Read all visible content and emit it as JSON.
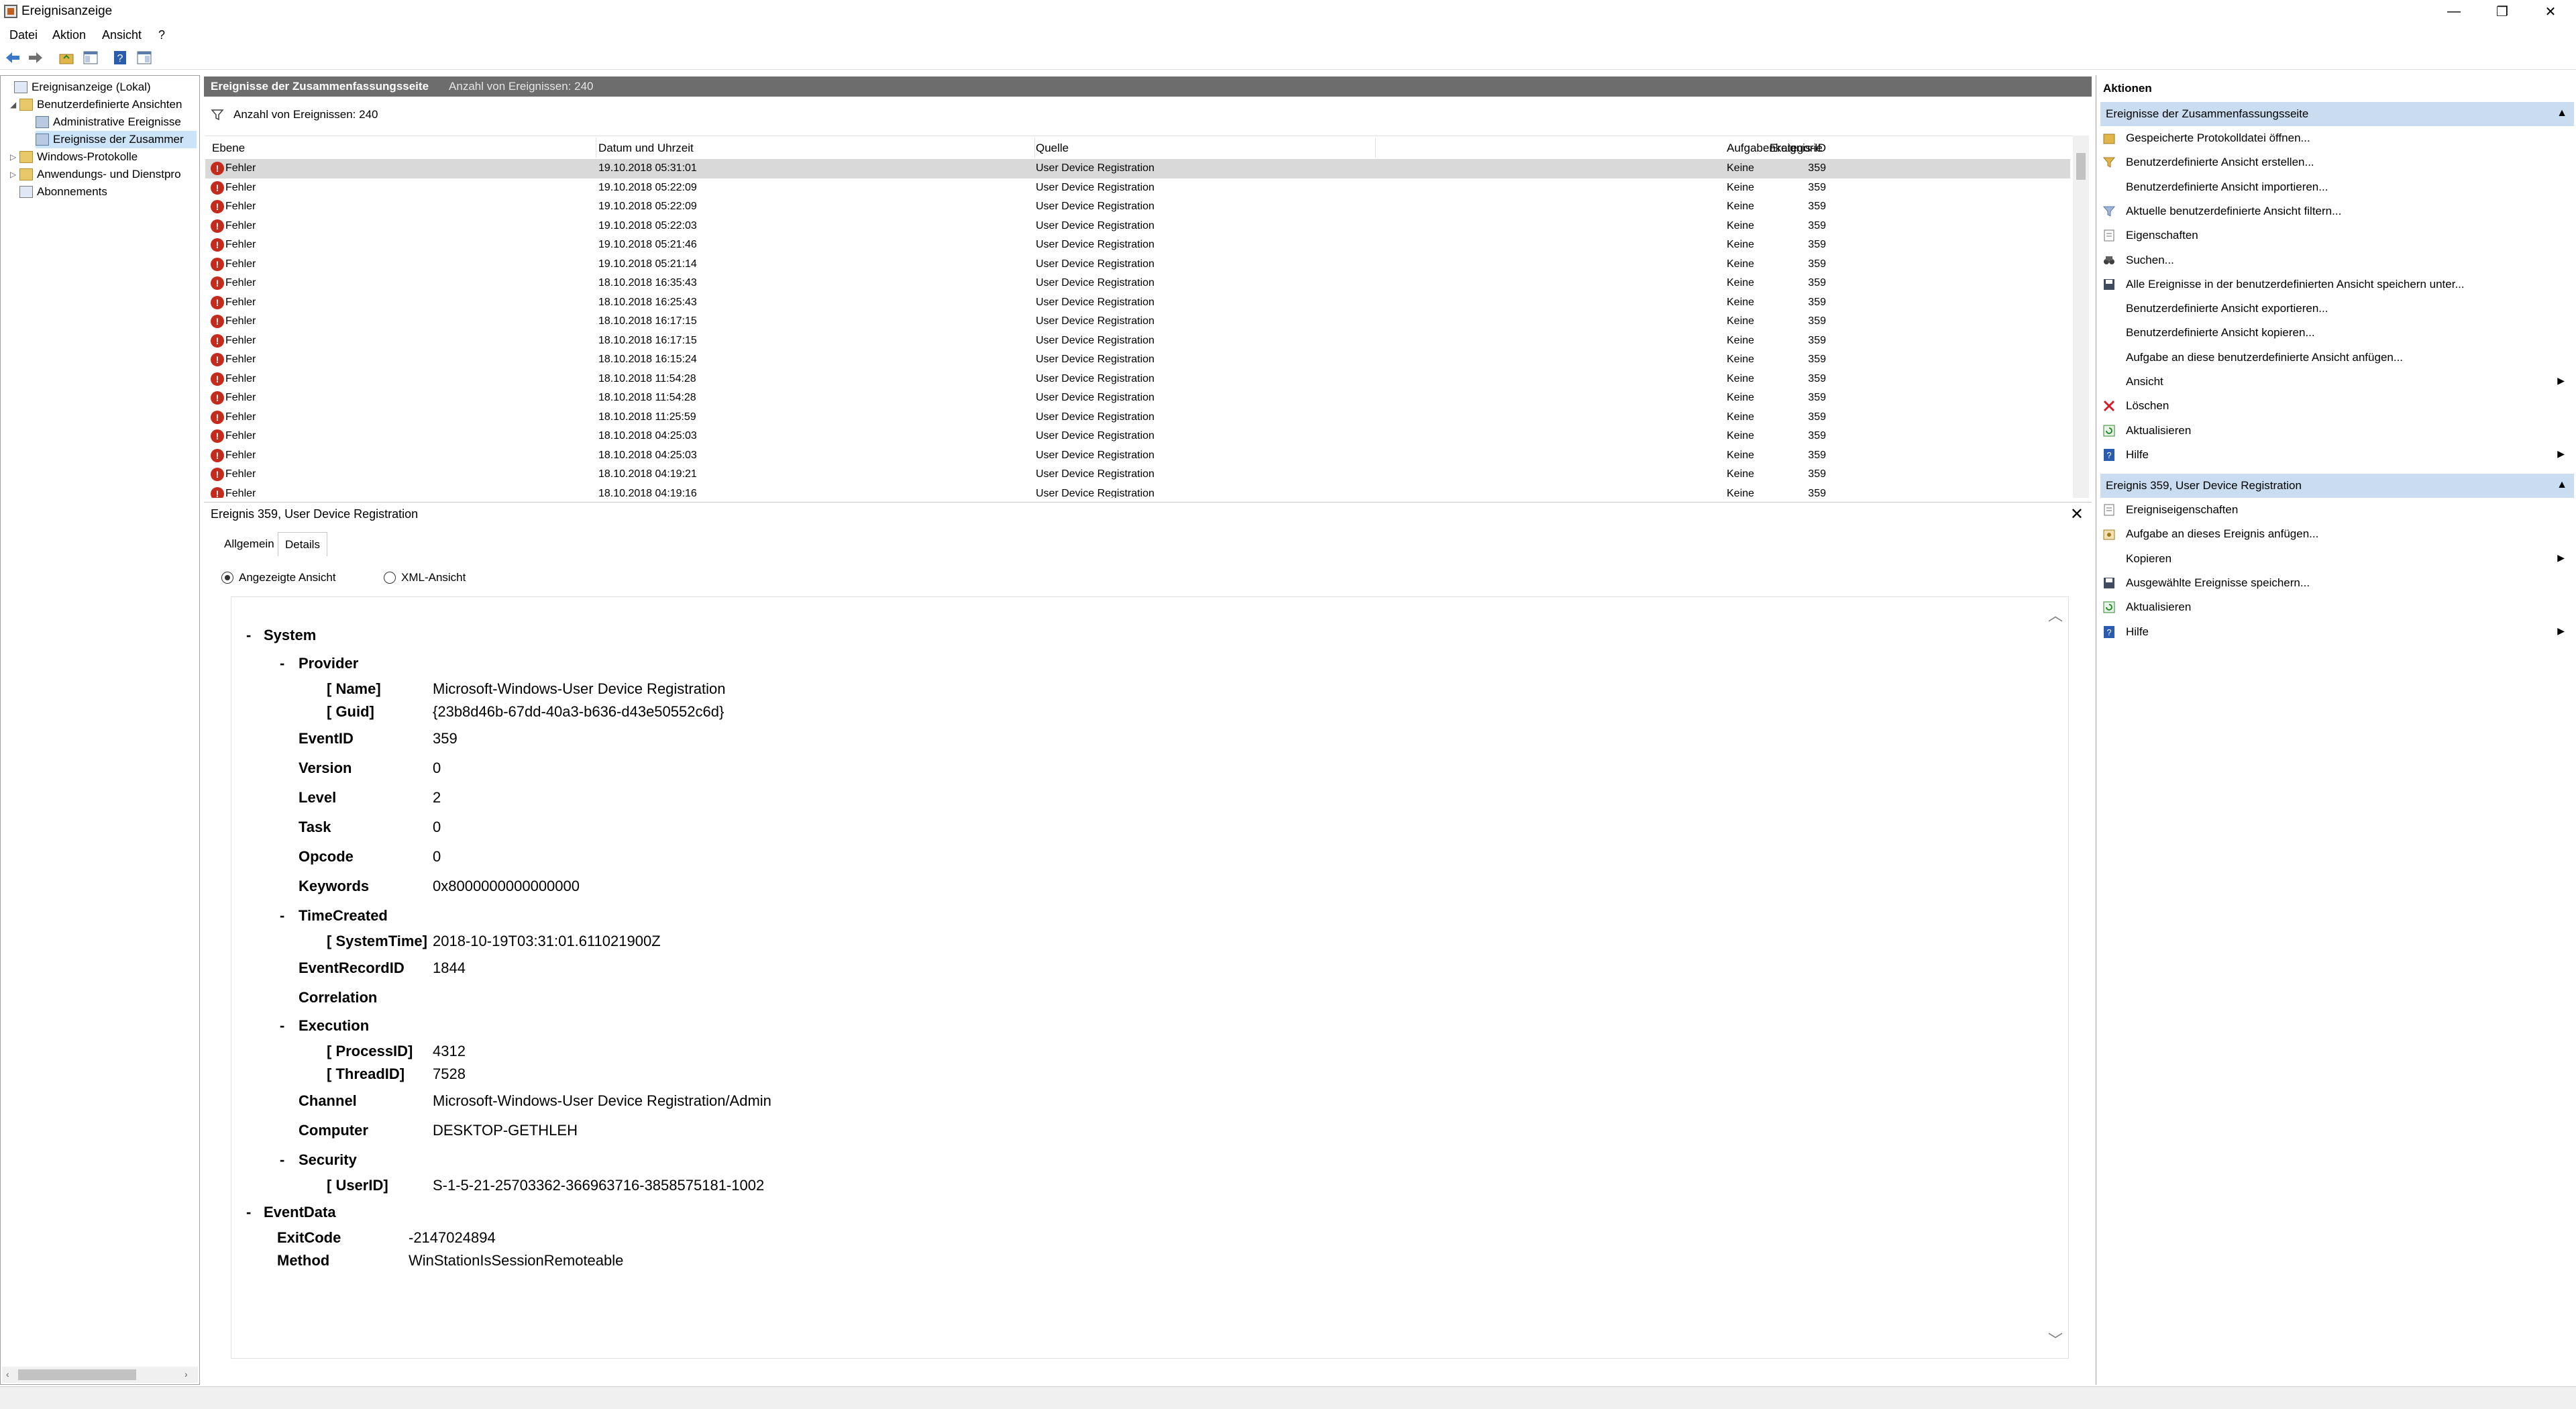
{
  "window": {
    "title": "Ereignisanzeige",
    "minimize": "—",
    "restore": "❐",
    "close": "✕"
  },
  "menu": [
    "Datei",
    "Aktion",
    "Ansicht",
    "?"
  ],
  "tree": {
    "items": [
      {
        "label": "Ereignisanzeige (Lokal)"
      },
      {
        "label": "Benutzerdefinierte Ansichten"
      },
      {
        "label": "Administrative Ereignisse"
      },
      {
        "label": "Ereignisse der Zusammer"
      },
      {
        "label": "Windows-Protokolle"
      },
      {
        "label": "Anwendungs- und Dienstpro"
      },
      {
        "label": "Abonnements"
      }
    ]
  },
  "summary": {
    "title": "Ereignisse der Zusammenfassungsseite",
    "count_label": "Anzahl von Ereignissen: 240",
    "filter_text": "Anzahl von Ereignissen: 240"
  },
  "table": {
    "columns": [
      "Ebene",
      "Datum und Uhrzeit",
      "Quelle",
      "Ereignis-ID",
      "Aufgabenkategorie"
    ],
    "rows": [
      {
        "level": "Fehler",
        "date": "19.10.2018 05:31:01",
        "source": "User Device Registration",
        "id": "359",
        "category": "Keine"
      },
      {
        "level": "Fehler",
        "date": "19.10.2018 05:22:09",
        "source": "User Device Registration",
        "id": "359",
        "category": "Keine"
      },
      {
        "level": "Fehler",
        "date": "19.10.2018 05:22:09",
        "source": "User Device Registration",
        "id": "359",
        "category": "Keine"
      },
      {
        "level": "Fehler",
        "date": "19.10.2018 05:22:03",
        "source": "User Device Registration",
        "id": "359",
        "category": "Keine"
      },
      {
        "level": "Fehler",
        "date": "19.10.2018 05:21:46",
        "source": "User Device Registration",
        "id": "359",
        "category": "Keine"
      },
      {
        "level": "Fehler",
        "date": "19.10.2018 05:21:14",
        "source": "User Device Registration",
        "id": "359",
        "category": "Keine"
      },
      {
        "level": "Fehler",
        "date": "18.10.2018 16:35:43",
        "source": "User Device Registration",
        "id": "359",
        "category": "Keine"
      },
      {
        "level": "Fehler",
        "date": "18.10.2018 16:25:43",
        "source": "User Device Registration",
        "id": "359",
        "category": "Keine"
      },
      {
        "level": "Fehler",
        "date": "18.10.2018 16:17:15",
        "source": "User Device Registration",
        "id": "359",
        "category": "Keine"
      },
      {
        "level": "Fehler",
        "date": "18.10.2018 16:17:15",
        "source": "User Device Registration",
        "id": "359",
        "category": "Keine"
      },
      {
        "level": "Fehler",
        "date": "18.10.2018 16:15:24",
        "source": "User Device Registration",
        "id": "359",
        "category": "Keine"
      },
      {
        "level": "Fehler",
        "date": "18.10.2018 11:54:28",
        "source": "User Device Registration",
        "id": "359",
        "category": "Keine"
      },
      {
        "level": "Fehler",
        "date": "18.10.2018 11:54:28",
        "source": "User Device Registration",
        "id": "359",
        "category": "Keine"
      },
      {
        "level": "Fehler",
        "date": "18.10.2018 11:25:59",
        "source": "User Device Registration",
        "id": "359",
        "category": "Keine"
      },
      {
        "level": "Fehler",
        "date": "18.10.2018 04:25:03",
        "source": "User Device Registration",
        "id": "359",
        "category": "Keine"
      },
      {
        "level": "Fehler",
        "date": "18.10.2018 04:25:03",
        "source": "User Device Registration",
        "id": "359",
        "category": "Keine"
      },
      {
        "level": "Fehler",
        "date": "18.10.2018 04:19:21",
        "source": "User Device Registration",
        "id": "359",
        "category": "Keine"
      },
      {
        "level": "Fehler",
        "date": "18.10.2018 04:19:16",
        "source": "User Device Registration",
        "id": "359",
        "category": "Keine"
      }
    ]
  },
  "detail": {
    "title": "Ereignis 359, User Device Registration",
    "tabs": [
      "Allgemein",
      "Details"
    ],
    "active_tab": "Details",
    "radio_friendly": "Angezeigte Ansicht",
    "radio_xml": "XML-Ansicht",
    "xml": {
      "system_label": "System",
      "provider_label": "Provider",
      "name_label": "[ Name]",
      "name_value": "Microsoft-Windows-User Device Registration",
      "guid_label": "[ Guid]",
      "guid_value": "{23b8d46b-67dd-40a3-b636-d43e50552c6d}",
      "eventid_label": "EventID",
      "eventid_value": "359",
      "version_label": "Version",
      "version_value": "0",
      "level_label": "Level",
      "level_value": "2",
      "task_label": "Task",
      "task_value": "0",
      "opcode_label": "Opcode",
      "opcode_value": "0",
      "keywords_label": "Keywords",
      "keywords_value": "0x8000000000000000",
      "timecreated_label": "TimeCreated",
      "systemtime_label": "[ SystemTime]",
      "systemtime_value": "2018-10-19T03:31:01.611021900Z",
      "eventrecordid_label": "EventRecordID",
      "eventrecordid_value": "1844",
      "correlation_label": "Correlation",
      "execution_label": "Execution",
      "processid_label": "[ ProcessID]",
      "processid_value": "4312",
      "threadid_label": "[ ThreadID]",
      "threadid_value": "7528",
      "channel_label": "Channel",
      "channel_value": "Microsoft-Windows-User Device Registration/Admin",
      "computer_label": "Computer",
      "computer_value": "DESKTOP-GETHLEH",
      "security_label": "Security",
      "userid_label": "[ UserID]",
      "userid_value": "S-1-5-21-25703362-366963716-3858575181-1002",
      "eventdata_label": "EventData",
      "exitcode_label": "ExitCode",
      "exitcode_value": "-2147024894",
      "method_label": "Method",
      "method_value": "WinStationIsSessionRemoteable",
      "collapse_glyph": "-"
    }
  },
  "actions": {
    "title": "Aktionen",
    "section1": {
      "title": "Ereignisse der Zusammenfassungsseite",
      "items": [
        {
          "label": "Gespeicherte Protokolldatei öffnen...",
          "icon": "open-log-icon"
        },
        {
          "label": "Benutzerdefinierte Ansicht erstellen...",
          "icon": "create-view-icon"
        },
        {
          "label": "Benutzerdefinierte Ansicht importieren...",
          "icon": ""
        },
        {
          "label": "Aktuelle benutzerdefinierte Ansicht filtern...",
          "icon": "filter-icon"
        },
        {
          "label": "Eigenschaften",
          "icon": "properties-icon"
        },
        {
          "label": "Suchen...",
          "icon": "binoculars-icon"
        },
        {
          "label": "Alle Ereignisse in der benutzerdefinierten Ansicht speichern unter...",
          "icon": "save-icon"
        },
        {
          "label": "Benutzerdefinierte Ansicht exportieren...",
          "icon": ""
        },
        {
          "label": "Benutzerdefinierte Ansicht kopieren...",
          "icon": ""
        },
        {
          "label": "Aufgabe an diese benutzerdefinierte Ansicht anfügen...",
          "icon": ""
        },
        {
          "label": "Ansicht",
          "icon": "",
          "submenu": true
        },
        {
          "label": "Löschen",
          "icon": "delete-icon"
        },
        {
          "label": "Aktualisieren",
          "icon": "refresh-icon"
        },
        {
          "label": "Hilfe",
          "icon": "help-icon",
          "submenu": true
        }
      ]
    },
    "section2": {
      "title": "Ereignis 359, User Device Registration",
      "items": [
        {
          "label": "Ereigniseigenschaften",
          "icon": "event-properties-icon"
        },
        {
          "label": "Aufgabe an dieses Ereignis anfügen...",
          "icon": "attach-task-icon"
        },
        {
          "label": "Kopieren",
          "icon": "",
          "submenu": true
        },
        {
          "label": "Ausgewählte Ereignisse speichern...",
          "icon": "save-icon"
        },
        {
          "label": "Aktualisieren",
          "icon": "refresh-icon"
        },
        {
          "label": "Hilfe",
          "icon": "help-icon",
          "submenu": true
        }
      ]
    }
  },
  "colors": {
    "error": "#c42b1c",
    "section_bg": "#c9dcf0",
    "header_bg": "#6d6d6d",
    "tree_selected": "#cce4f7"
  }
}
